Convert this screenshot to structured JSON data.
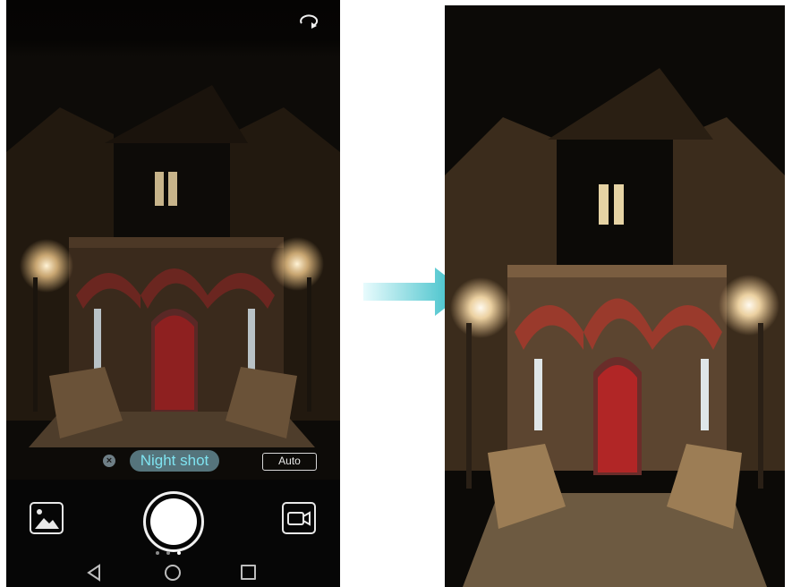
{
  "camera": {
    "top_bar": {
      "switch_camera_icon": "switch-camera-icon"
    },
    "mode_bar": {
      "close_icon": "close-icon",
      "mode_label": "Night shot",
      "auto_label": "Auto"
    },
    "controls": {
      "gallery_icon": "gallery-icon",
      "shutter_icon": "shutter-icon",
      "video_icon": "video-camera-icon",
      "page_dots": 3,
      "active_dot": 2
    },
    "navbar": {
      "back_icon": "back-icon",
      "home_icon": "home-icon",
      "recent_icon": "recent-apps-icon"
    }
  },
  "arrow_icon": "right-arrow-icon",
  "colors": {
    "accent": "#7fe3f0",
    "chip_bg": "#55747c",
    "arrow_start": "#e8fbfd",
    "arrow_end": "#2bb9c3",
    "door": "#8e2020",
    "brick": "#7a2a22"
  }
}
